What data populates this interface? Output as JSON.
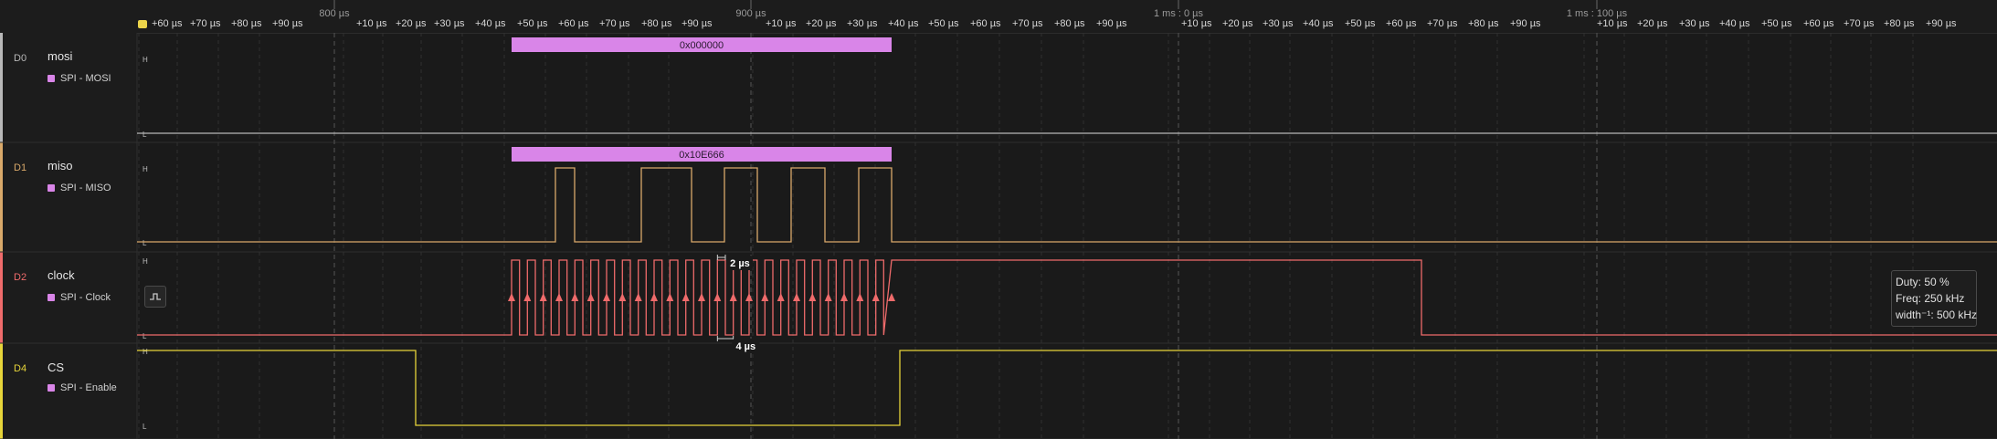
{
  "timeline": {
    "major_labels": [
      "800 µs",
      "900 µs",
      "1 ms : 0 µs",
      "1 ms : 100 µs"
    ],
    "tick_labels": [
      "+60 µs",
      "+70 µs",
      "+80 µs",
      "+90 µs",
      "+10 µs",
      "+20 µs",
      "+30 µs",
      "+40 µs",
      "+50 µs",
      "+60 µs",
      "+70 µs",
      "+80 µs",
      "+90 µs",
      "+10 µs",
      "+20 µs",
      "+30 µs",
      "+40 µs",
      "+50 µs",
      "+60 µs",
      "+70 µs",
      "+80 µs",
      "+90 µs",
      "+10 µs",
      "+20 µs",
      "+30 µs",
      "+40 µs",
      "+50 µs",
      "+60 µs",
      "+70 µs",
      "+80 µs",
      "+90 µs",
      "+10 µs",
      "+20 µs",
      "+30 µs",
      "+40 µs",
      "+50 µs",
      "+60 µs",
      "+70 µs",
      "+80 µs",
      "+90 µs"
    ]
  },
  "channels": [
    {
      "id": "D0",
      "name": "mosi",
      "analyzer": "SPI - MOSI",
      "color": "#b8b8b8",
      "high_label": "H",
      "low_label": "L"
    },
    {
      "id": "D1",
      "name": "miso",
      "analyzer": "SPI - MISO",
      "color": "#d9a96a",
      "high_label": "H",
      "low_label": "L"
    },
    {
      "id": "D2",
      "name": "clock",
      "analyzer": "SPI - Clock",
      "color": "#ef6b6b",
      "high_label": "H",
      "low_label": "L"
    },
    {
      "id": "D4",
      "name": "CS",
      "analyzer": "SPI - Enable",
      "color": "#e6d43a",
      "high_label": "H",
      "low_label": "L"
    }
  ],
  "decoded": {
    "mosi": "0x000000",
    "miso": "0x10E666"
  },
  "measurements": {
    "clock_width": "2 µs",
    "clock_period": "4 µs"
  },
  "measure_box": {
    "duty": "Duty: 50 %",
    "freq": "Freq: 250 kHz",
    "width": "width⁻¹: 500 kHz"
  },
  "colors": {
    "analyzer": "#d985e8",
    "background": "#1a1a1a"
  }
}
